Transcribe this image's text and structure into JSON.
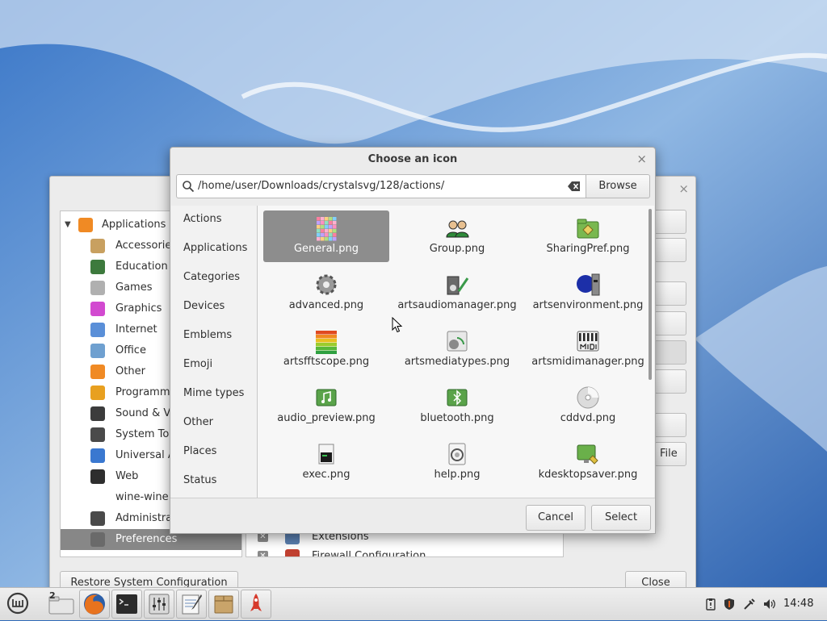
{
  "dialog": {
    "title": "Choose an icon",
    "path_value": "/home/user/Downloads/crystalsvg/128/actions/",
    "browse_label": "Browse",
    "cancel_label": "Cancel",
    "select_label": "Select",
    "categories": [
      "Actions",
      "Applications",
      "Categories",
      "Devices",
      "Emblems",
      "Emoji",
      "Mime types",
      "Other",
      "Places",
      "Status"
    ],
    "icons": [
      {
        "name": "General.png",
        "icon": "color-grid-icon",
        "selected": true
      },
      {
        "name": "Group.png",
        "icon": "group-users-icon"
      },
      {
        "name": "SharingPref.png",
        "icon": "shared-folder-icon"
      },
      {
        "name": "advanced.png",
        "icon": "gear-icon"
      },
      {
        "name": "artsaudiomanager.png",
        "icon": "audio-manager-icon"
      },
      {
        "name": "artsenvironment.png",
        "icon": "environment-icon"
      },
      {
        "name": "artsfftscope.png",
        "icon": "fft-scope-icon"
      },
      {
        "name": "artsmediatypes.png",
        "icon": "media-types-icon"
      },
      {
        "name": "artsmidimanager.png",
        "icon": "midi-manager-icon"
      },
      {
        "name": "audio_preview.png",
        "icon": "audio-note-icon"
      },
      {
        "name": "bluetooth.png",
        "icon": "bluetooth-icon"
      },
      {
        "name": "cddvd.png",
        "icon": "cd-disc-icon"
      },
      {
        "name": "exec.png",
        "icon": "exec-icon"
      },
      {
        "name": "help.png",
        "icon": "help-icon"
      },
      {
        "name": "kdesktopsaver.png",
        "icon": "desktop-saver-icon"
      }
    ]
  },
  "menu_editor": {
    "tree": [
      {
        "label": "Applications",
        "level": "root",
        "color": "#f08a24"
      },
      {
        "label": "Accessories",
        "level": "child",
        "color": "#c8a060"
      },
      {
        "label": "Education",
        "level": "child",
        "color": "#3d7a3d"
      },
      {
        "label": "Games",
        "level": "child",
        "color": "#b0b0b0"
      },
      {
        "label": "Graphics",
        "level": "child",
        "color": "#d24ad0"
      },
      {
        "label": "Internet",
        "level": "child",
        "color": "#5a8fd8"
      },
      {
        "label": "Office",
        "level": "child",
        "color": "#6fa0d0"
      },
      {
        "label": "Other",
        "level": "child",
        "color": "#f08a24"
      },
      {
        "label": "Programmi",
        "level": "child",
        "color": "#e8a020"
      },
      {
        "label": "Sound & Vi",
        "level": "child",
        "color": "#3c3c3c"
      },
      {
        "label": "System Too",
        "level": "child",
        "color": "#4a4a4a"
      },
      {
        "label": "Universal A",
        "level": "child",
        "color": "#3a78d0"
      },
      {
        "label": "Web",
        "level": "child",
        "color": "#2e2e2e"
      },
      {
        "label": "wine-wine",
        "level": "child",
        "color": ""
      },
      {
        "label": "Administrat",
        "level": "child",
        "color": "#4a4a4a"
      },
      {
        "label": "Preferences",
        "level": "child",
        "color": "#6a6a6a",
        "selected": true
      }
    ],
    "items": [
      {
        "label": "Extensions",
        "color": "#5a7fb0"
      },
      {
        "label": "Firewall Configuration",
        "color": "#c04030"
      }
    ],
    "file_label": "File",
    "restore_label": "Restore System Configuration",
    "close_label": "Close",
    "close_icon": "×"
  },
  "taskbar": {
    "workspace_badge": "2",
    "clock": "14:48",
    "apps": [
      "mint-menu-icon",
      "file-manager-icon",
      "firefox-icon",
      "terminal-icon",
      "mixer-icon",
      "text-editor-icon",
      "package-icon",
      "rocket-icon"
    ]
  },
  "colors": {
    "selection": "#8d8d8d",
    "dialog_bg": "#ececec",
    "desktop": "#2f6ab8"
  }
}
